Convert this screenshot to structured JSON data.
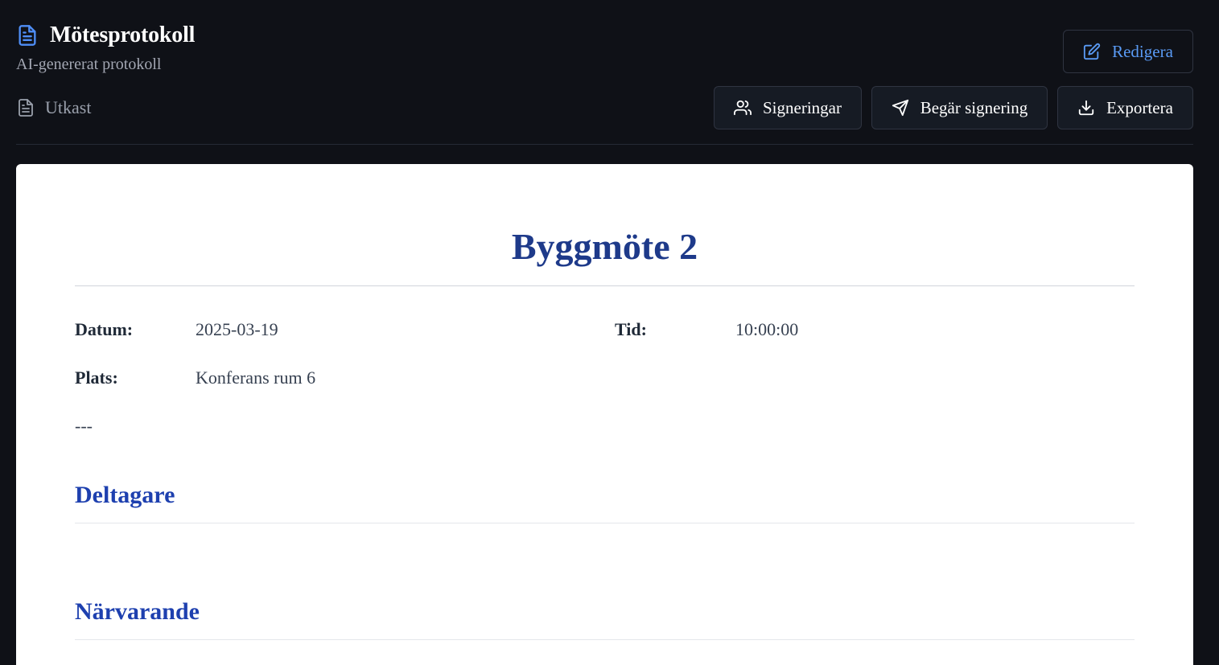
{
  "header": {
    "title": "Mötesprotokoll",
    "subtitle": "AI-genererat protokoll",
    "status": "Utkast"
  },
  "toolbar": {
    "edit_label": "Redigera",
    "signatures_label": "Signeringar",
    "request_signature_label": "Begär signering",
    "export_label": "Exportera"
  },
  "document": {
    "title": "Byggmöte 2",
    "meta": {
      "date_label": "Datum:",
      "date_value": "2025-03-19",
      "time_label": "Tid:",
      "time_value": "10:00:00",
      "place_label": "Plats:",
      "place_value": "Konferans rum 6"
    },
    "separator": "---",
    "sections": {
      "participants": "Deltagare",
      "present": "Närvarande"
    }
  },
  "colors": {
    "background": "#0f1117",
    "accent": "#4f8ef7",
    "heading": "#1e3a8a"
  },
  "icons": {
    "title": "document-icon",
    "status": "document-outline-icon",
    "edit": "pencil-square-icon",
    "signatures": "users-icon",
    "request_signature": "send-icon",
    "export": "download-icon"
  }
}
